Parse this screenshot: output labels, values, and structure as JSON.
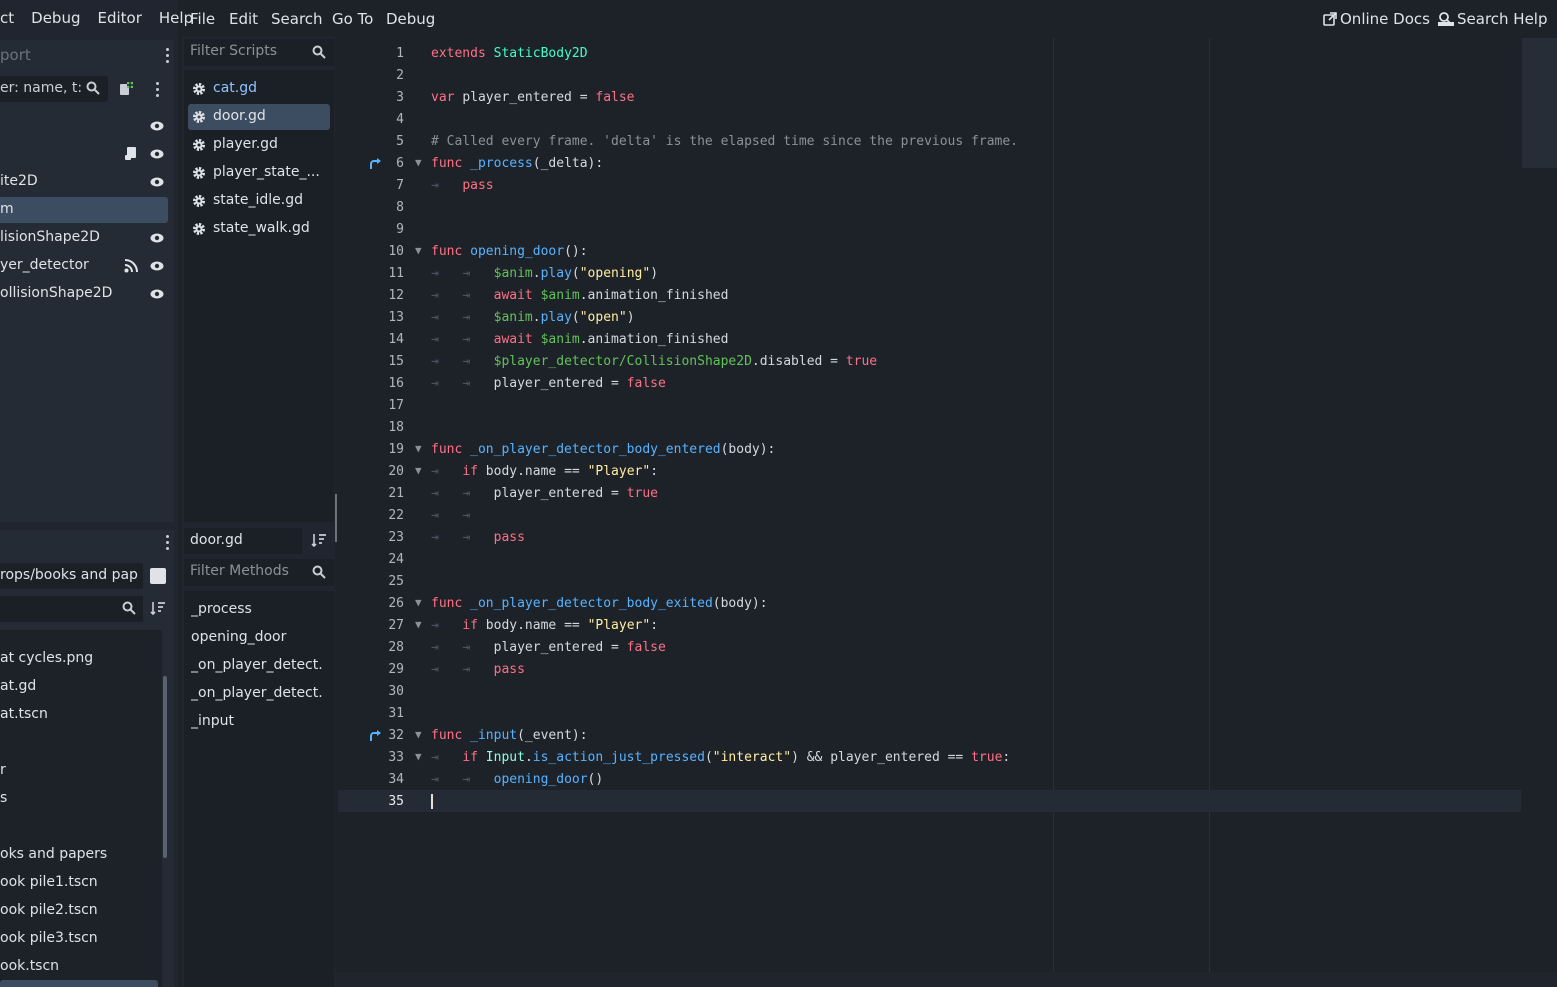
{
  "left_menu": [
    "ct",
    "Debug",
    "Editor",
    "Help"
  ],
  "scene": {
    "title_fragment": "port",
    "filter_placeholder": "er: name, t:t",
    "nodes": [
      {
        "label": ""
      },
      {
        "label": ""
      },
      {
        "label": "ite2D"
      },
      {
        "label": "m"
      },
      {
        "label": "lisionShape2D"
      },
      {
        "label": "yer_detector"
      },
      {
        "label": "ollisionShape2D"
      }
    ]
  },
  "filesystem": {
    "path": "rops/books and pap",
    "items": [
      "at cycles.png",
      "at.gd",
      "at.tscn",
      "r",
      "s",
      "oks and papers",
      "ook pile1.tscn",
      "ook pile2.tscn",
      "ook pile3.tscn",
      "ook.tscn"
    ]
  },
  "scripts": {
    "filter_placeholder": "Filter Scripts",
    "items": [
      "cat.gd",
      "door.gd",
      "player.gd",
      "player_state_...",
      "state_idle.gd",
      "state_walk.gd"
    ],
    "current_file": "door.gd",
    "methods_placeholder": "Filter Methods",
    "methods": [
      "_process",
      "opening_door",
      "_on_player_detect...",
      "_on_player_detect...",
      "_input"
    ]
  },
  "editor_menu": [
    "File",
    "Edit",
    "Search",
    "Go To",
    "Debug"
  ],
  "help_buttons": {
    "online_docs": "Online Docs",
    "search_help": "Search Help"
  },
  "code": {
    "line_numbers": [
      "1",
      "2",
      "3",
      "4",
      "5",
      "6",
      "7",
      "8",
      "9",
      "10",
      "11",
      "12",
      "13",
      "14",
      "15",
      "16",
      "17",
      "18",
      "19",
      "20",
      "21",
      "22",
      "23",
      "24",
      "25",
      "26",
      "27",
      "28",
      "29",
      "30",
      "31",
      "32",
      "33",
      "34",
      "35"
    ],
    "t1a": "extends",
    "t1b": "StaticBody2D",
    "t3a": "var",
    "t3b": "player_entered =",
    "t3c": "false",
    "t5": "# Called every frame. 'delta' is the elapsed time since the previous frame.",
    "func": "func",
    "t6b": "_process",
    "t6c": "(_delta):",
    "pass": "pass",
    "t10b": "opening_door",
    "t10c": "():",
    "anim": "$anim",
    "dot": ".",
    "play": "play",
    "lp": "(",
    "rp": ")",
    "s_opening": "\"opening\"",
    "s_open": "\"open\"",
    "await": "await",
    "anim_finished": ".animation_finished",
    "t15a": "$player_detector/CollisionShape2D",
    "t15b": ".disabled =",
    "true": "true",
    "false": "false",
    "pe_eq": "player_entered =",
    "t19b": "_on_player_detector_body_entered",
    "body_args": "(body):",
    "if": "if",
    "body_name": "body.name",
    "eqeq": "==",
    "s_player": "\"Player\"",
    "colon": ":",
    "t26b": "_on_player_detector_body_exited",
    "t32b": "_input",
    "t32c": "(_event):",
    "input_obj": "Input",
    "ijp": "is_action_just_pressed",
    "s_interact": "\"interact\"",
    "t33and": ") && player_entered",
    "t34": "opening_door",
    "paren_empty": "()",
    "tab": "⇥"
  }
}
